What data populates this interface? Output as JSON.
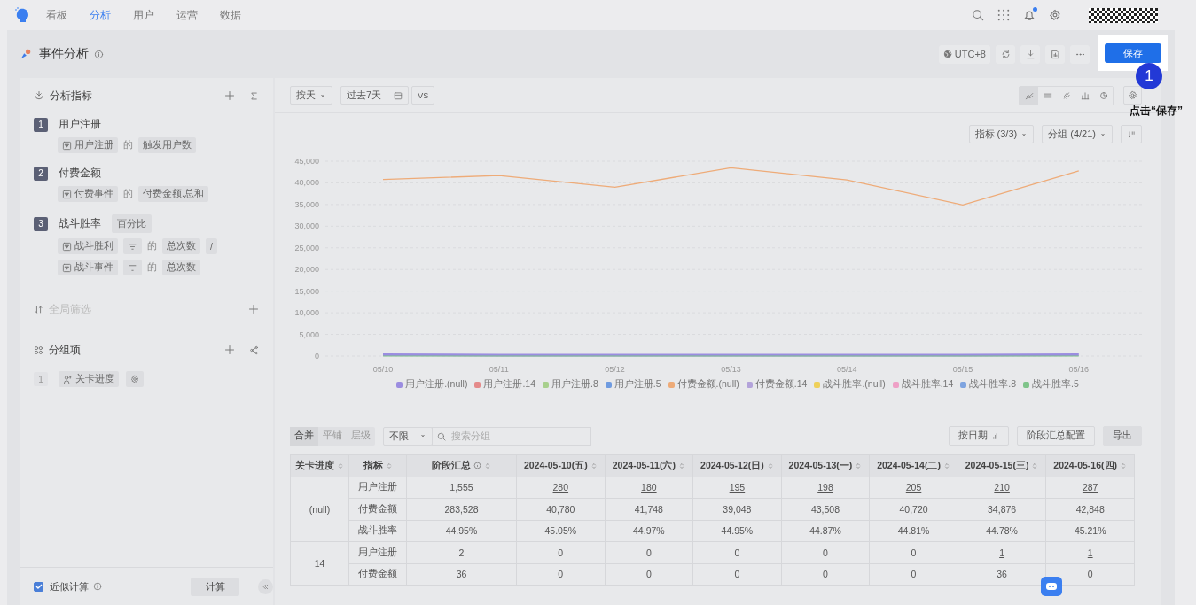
{
  "nav": {
    "tabs": [
      {
        "label": "看板",
        "selected": false
      },
      {
        "label": "分析",
        "selected": true
      },
      {
        "label": "用户",
        "selected": false
      },
      {
        "label": "运营",
        "selected": false
      },
      {
        "label": "数据",
        "selected": false
      }
    ],
    "notifications": {
      "unread": true
    }
  },
  "page": {
    "title": "事件分析"
  },
  "header_actions": {
    "timezone": "UTC+8",
    "save": "保存"
  },
  "guide": {
    "step": "1",
    "text": "点击“保存”"
  },
  "sidebar": {
    "metrics_title": "分析指标",
    "metrics": [
      {
        "index": "1",
        "name": "用户注册",
        "lines": [
          [
            {
              "kind": "event",
              "text": "用户注册"
            },
            {
              "kind": "of",
              "text": "的"
            },
            {
              "kind": "chip",
              "text": "触发用户数"
            }
          ]
        ]
      },
      {
        "index": "2",
        "name": "付费金额",
        "lines": [
          [
            {
              "kind": "event",
              "text": "付费事件"
            },
            {
              "kind": "of",
              "text": "的"
            },
            {
              "kind": "chip",
              "text": "付费金额.总和"
            }
          ]
        ]
      },
      {
        "index": "3",
        "name": "战斗胜率",
        "tag": "百分比",
        "lines": [
          [
            {
              "kind": "event",
              "text": "战斗胜利"
            },
            {
              "kind": "filter"
            },
            {
              "kind": "of",
              "text": "的"
            },
            {
              "kind": "chip",
              "text": "总次数"
            },
            {
              "kind": "chip",
              "text": "/"
            }
          ],
          [
            {
              "kind": "event",
              "text": "战斗事件"
            },
            {
              "kind": "filter"
            },
            {
              "kind": "of",
              "text": "的"
            },
            {
              "kind": "chip",
              "text": "总次数"
            }
          ]
        ]
      }
    ],
    "filter_title": "全局筛选",
    "groups_title": "分组项",
    "groups": [
      {
        "index": "1",
        "name": "关卡进度"
      }
    ],
    "approx": {
      "label": "近似计算",
      "checked": true
    },
    "compute": "计算"
  },
  "toolbar": {
    "granularity": "按天",
    "range": "过去7天",
    "compare": "VS"
  },
  "chart_types": [
    {
      "kind": "line",
      "selected": true
    },
    {
      "kind": "stack",
      "selected": false
    },
    {
      "kind": "trend",
      "selected": false
    },
    {
      "kind": "bar",
      "selected": false
    },
    {
      "kind": "pie",
      "selected": false
    }
  ],
  "chart_filters": {
    "metrics": "指标 (3/3)",
    "groups": "分组 (4/21)"
  },
  "chart_data": {
    "type": "line",
    "grid": true,
    "legend": "bottom",
    "categories": [
      "05/10",
      "05/11",
      "05/12",
      "05/13",
      "05/14",
      "05/15",
      "05/16"
    ],
    "ylim": [
      0,
      45000
    ],
    "yticks": [
      {
        "value": 0,
        "label": "0"
      },
      {
        "value": 5000,
        "label": "5,000"
      },
      {
        "value": 10000,
        "label": "10,000"
      },
      {
        "value": 15000,
        "label": "15,000"
      },
      {
        "value": 20000,
        "label": "20,000"
      },
      {
        "value": 25000,
        "label": "25,000"
      },
      {
        "value": 30000,
        "label": "30,000"
      },
      {
        "value": 35000,
        "label": "35,000"
      },
      {
        "value": 40000,
        "label": "40,000"
      },
      {
        "value": 45000,
        "label": "45,000"
      }
    ],
    "series": [
      {
        "name": "用户注册.(null)",
        "color": "#9b8de0",
        "values": [
          300,
          200,
          200,
          200,
          200,
          200,
          300
        ]
      },
      {
        "name": "用户注册.14",
        "color": "#e48a8a",
        "values": [
          null,
          null,
          null,
          null,
          null,
          null,
          null
        ]
      },
      {
        "name": "用户注册.8",
        "color": "#a8d08d",
        "values": [
          null,
          null,
          null,
          null,
          null,
          null,
          null
        ]
      },
      {
        "name": "用户注册.5",
        "color": "#6f9be0",
        "values": [
          null,
          null,
          null,
          null,
          null,
          null,
          null
        ]
      },
      {
        "name": "付费金额.(null)",
        "color": "#eeab78",
        "values": [
          40800,
          41700,
          39000,
          43500,
          40700,
          34900,
          42800
        ]
      },
      {
        "name": "付费金额.14",
        "color": "#b3a3da",
        "values": [
          null,
          null,
          null,
          null,
          null,
          null,
          null
        ]
      },
      {
        "name": "战斗胜率.(null)",
        "color": "#eed05a",
        "values": [
          null,
          null,
          null,
          null,
          null,
          null,
          null
        ]
      },
      {
        "name": "战斗胜率.14",
        "color": "#eea0c6",
        "values": [
          null,
          null,
          null,
          null,
          null,
          null,
          null
        ]
      },
      {
        "name": "战斗胜率.8",
        "color": "#7ea4e0",
        "values": [
          null,
          null,
          null,
          null,
          null,
          null,
          null
        ]
      },
      {
        "name": "战斗胜率.5",
        "color": "#7fc48a",
        "values": [
          0,
          0,
          0,
          0,
          0,
          0,
          0
        ]
      }
    ]
  },
  "table_toolbar": {
    "modes": [
      {
        "label": "合并",
        "selected": true
      },
      {
        "label": "平铺",
        "selected": false
      },
      {
        "label": "层级",
        "selected": false
      }
    ],
    "scope": "不限",
    "search": {
      "placeholder": "搜索分组"
    },
    "by_date": "按日期",
    "config": "阶段汇总配置",
    "export": "导出"
  },
  "table": {
    "columns": [
      {
        "label": "关卡进度"
      },
      {
        "label": "指标"
      },
      {
        "label": "阶段汇总",
        "info": true
      },
      {
        "label": "2024-05-10(五)"
      },
      {
        "label": "2024-05-11(六)"
      },
      {
        "label": "2024-05-12(日)"
      },
      {
        "label": "2024-05-13(一)"
      },
      {
        "label": "2024-05-14(二)"
      },
      {
        "label": "2024-05-15(三)"
      },
      {
        "label": "2024-05-16(四)"
      }
    ],
    "groups": [
      {
        "name": "(null)",
        "rows": [
          {
            "metric": "用户注册",
            "total": "1,555",
            "cells": [
              {
                "text": "280",
                "link": true
              },
              {
                "text": "180",
                "link": true
              },
              {
                "text": "195",
                "link": true
              },
              {
                "text": "198",
                "link": true
              },
              {
                "text": "205",
                "link": true
              },
              {
                "text": "210",
                "link": true
              },
              {
                "text": "287",
                "link": true
              }
            ]
          },
          {
            "metric": "付费金额",
            "total": "283,528",
            "cells": [
              {
                "text": "40,780",
                "link": false
              },
              {
                "text": "41,748",
                "link": false
              },
              {
                "text": "39,048",
                "link": false
              },
              {
                "text": "43,508",
                "link": false
              },
              {
                "text": "40,720",
                "link": false
              },
              {
                "text": "34,876",
                "link": false
              },
              {
                "text": "42,848",
                "link": false
              }
            ]
          },
          {
            "metric": "战斗胜率",
            "total": "44.95%",
            "cells": [
              {
                "text": "45.05%",
                "link": false
              },
              {
                "text": "44.97%",
                "link": false
              },
              {
                "text": "44.95%",
                "link": false
              },
              {
                "text": "44.87%",
                "link": false
              },
              {
                "text": "44.81%",
                "link": false
              },
              {
                "text": "44.78%",
                "link": false
              },
              {
                "text": "45.21%",
                "link": false
              }
            ]
          }
        ]
      },
      {
        "name": "14",
        "rows": [
          {
            "metric": "用户注册",
            "total": "2",
            "cells": [
              {
                "text": "0",
                "link": false
              },
              {
                "text": "0",
                "link": false
              },
              {
                "text": "0",
                "link": false
              },
              {
                "text": "0",
                "link": false
              },
              {
                "text": "0",
                "link": false
              },
              {
                "text": "1",
                "link": true
              },
              {
                "text": "1",
                "link": true
              }
            ]
          },
          {
            "metric": "付费金额",
            "total": "36",
            "cells": [
              {
                "text": "0",
                "link": false
              },
              {
                "text": "0",
                "link": false
              },
              {
                "text": "0",
                "link": false
              },
              {
                "text": "0",
                "link": false
              },
              {
                "text": "0",
                "link": false
              },
              {
                "text": "36",
                "link": false
              },
              {
                "text": "0",
                "link": false
              }
            ]
          }
        ]
      }
    ]
  }
}
